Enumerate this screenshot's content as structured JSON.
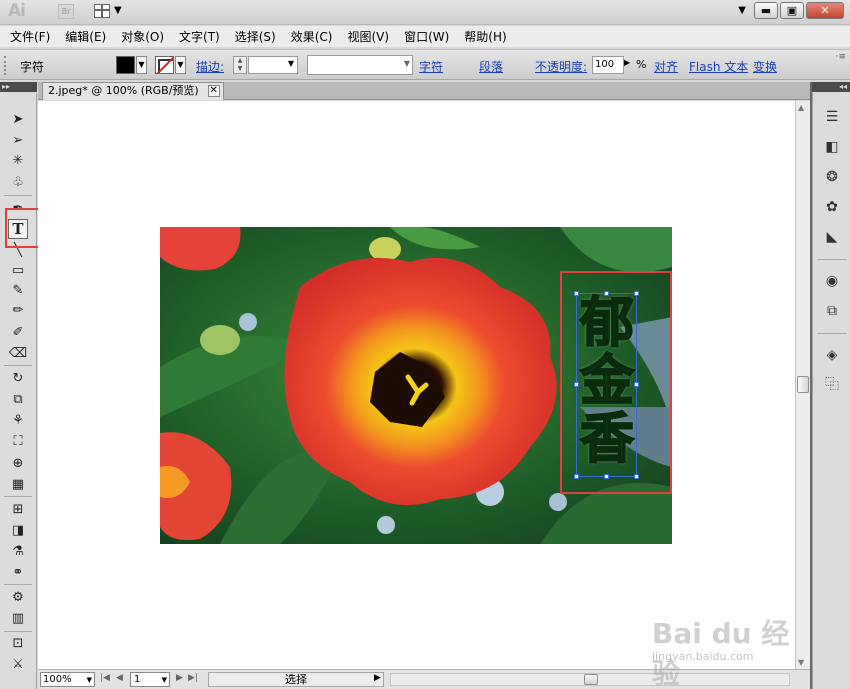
{
  "app": {
    "logo": "Ai",
    "bridge": "Br"
  },
  "menu": [
    "文件(F)",
    "编辑(E)",
    "对象(O)",
    "文字(T)",
    "选择(S)",
    "效果(C)",
    "视图(V)",
    "窗口(W)",
    "帮助(H)"
  ],
  "control": {
    "label": "字符",
    "stroke_label": "描边:",
    "char_link": "字符",
    "para_link": "段落",
    "opacity_label": "不透明度:",
    "opacity_value": "100",
    "percent": "%",
    "align_link": "对齐",
    "flash_link": "Flash 文本",
    "transform_link": "变换"
  },
  "document": {
    "tab_title": "2.jpeg* @ 100% (RGB/预览)",
    "close": "✕"
  },
  "artwork": {
    "vertical_text": [
      "郁",
      "金",
      "香"
    ]
  },
  "status": {
    "zoom": "100%",
    "page": "1",
    "mode": "选择"
  },
  "watermark": {
    "main": "Bai du 经验",
    "sub": "jingyan.baidu.com"
  },
  "colors": {
    "highlight": "#e04040",
    "selection": "#3a6cd4",
    "text_fill": "#124f1a"
  }
}
